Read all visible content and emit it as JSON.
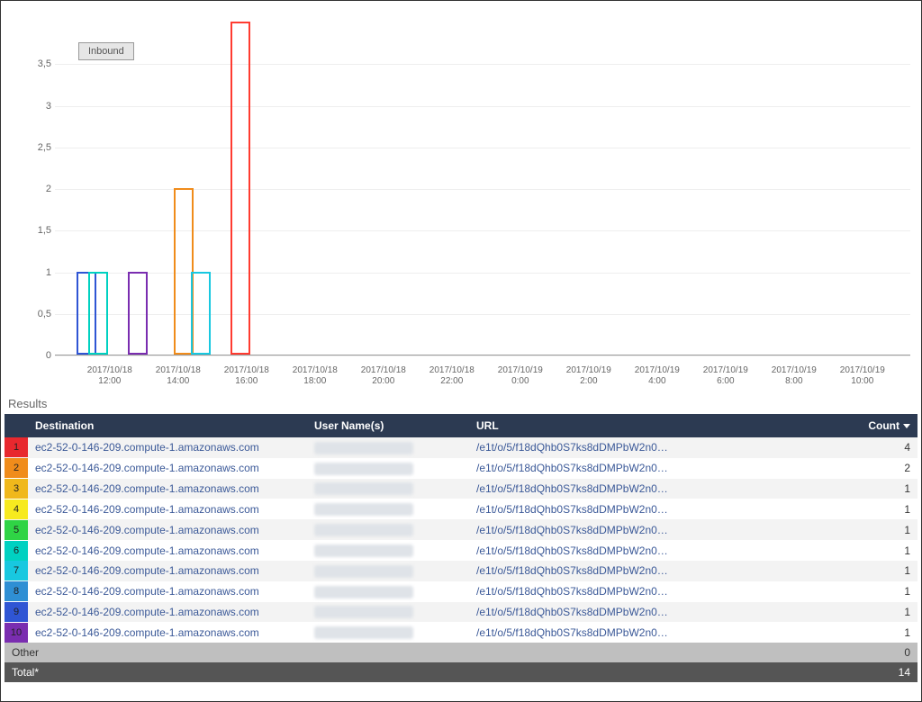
{
  "results_label": "Results",
  "legend": {
    "label": "Inbound"
  },
  "chart_data": {
    "type": "bar",
    "title": "",
    "xlabel": "",
    "ylabel": "",
    "ylim": [
      0,
      4
    ],
    "y_ticks": [
      0,
      0.5,
      1,
      1.5,
      2,
      2.5,
      3,
      3.5
    ],
    "x_ticks": [
      "2017/10/18\n12:00",
      "2017/10/18\n14:00",
      "2017/10/18\n16:00",
      "2017/10/18\n18:00",
      "2017/10/18\n20:00",
      "2017/10/18\n22:00",
      "2017/10/19\n0:00",
      "2017/10/19\n2:00",
      "2017/10/19\n4:00",
      "2017/10/19\n6:00",
      "2017/10/19\n8:00",
      "2017/10/19\n10:00"
    ],
    "series": [
      {
        "name": "1",
        "color": "#2f55d4",
        "x": "2017/10/18 11:20",
        "value": 1
      },
      {
        "name": "2",
        "color": "#00d1c1",
        "x": "2017/10/18 11:40",
        "value": 1
      },
      {
        "name": "3",
        "color": "#7a2db0",
        "x": "2017/10/18 12:50",
        "value": 1
      },
      {
        "name": "4",
        "color": "#f08c1b",
        "x": "2017/10/18 14:10",
        "value": 2
      },
      {
        "name": "5",
        "color": "#18c8e0",
        "x": "2017/10/18 14:40",
        "value": 1
      },
      {
        "name": "6",
        "color": "#ff3b30",
        "x": "2017/10/18 15:50",
        "value": 4
      }
    ],
    "legend": [
      "Inbound"
    ]
  },
  "table": {
    "headers": {
      "destination": "Destination",
      "user": "User Name(s)",
      "url": "URL",
      "count": "Count"
    },
    "rows": [
      {
        "idx": "1",
        "color": "#e8282e",
        "destination": "ec2-52-0-146-209.compute-1.amazonaws.com",
        "url": "/e1t/o/5/f18dQhb0S7ks8dDMPbW2n0…",
        "count": 4
      },
      {
        "idx": "2",
        "color": "#f08c1b",
        "destination": "ec2-52-0-146-209.compute-1.amazonaws.com",
        "url": "/e1t/o/5/f18dQhb0S7ks8dDMPbW2n0…",
        "count": 2
      },
      {
        "idx": "3",
        "color": "#f0b81b",
        "destination": "ec2-52-0-146-209.compute-1.amazonaws.com",
        "url": "/e1t/o/5/f18dQhb0S7ks8dDMPbW2n0…",
        "count": 1
      },
      {
        "idx": "4",
        "color": "#f7ea1f",
        "destination": "ec2-52-0-146-209.compute-1.amazonaws.com",
        "url": "/e1t/o/5/f18dQhb0S7ks8dDMPbW2n0…",
        "count": 1
      },
      {
        "idx": "5",
        "color": "#2fd445",
        "destination": "ec2-52-0-146-209.compute-1.amazonaws.com",
        "url": "/e1t/o/5/f18dQhb0S7ks8dDMPbW2n0…",
        "count": 1
      },
      {
        "idx": "6",
        "color": "#00d1c1",
        "destination": "ec2-52-0-146-209.compute-1.amazonaws.com",
        "url": "/e1t/o/5/f18dQhb0S7ks8dDMPbW2n0…",
        "count": 1
      },
      {
        "idx": "7",
        "color": "#18c8e0",
        "destination": "ec2-52-0-146-209.compute-1.amazonaws.com",
        "url": "/e1t/o/5/f18dQhb0S7ks8dDMPbW2n0…",
        "count": 1
      },
      {
        "idx": "8",
        "color": "#2f8fd4",
        "destination": "ec2-52-0-146-209.compute-1.amazonaws.com",
        "url": "/e1t/o/5/f18dQhb0S7ks8dDMPbW2n0…",
        "count": 1
      },
      {
        "idx": "9",
        "color": "#2f55d4",
        "destination": "ec2-52-0-146-209.compute-1.amazonaws.com",
        "url": "/e1t/o/5/f18dQhb0S7ks8dDMPbW2n0…",
        "count": 1
      },
      {
        "idx": "10",
        "color": "#7a2db0",
        "destination": "ec2-52-0-146-209.compute-1.amazonaws.com",
        "url": "/e1t/o/5/f18dQhb0S7ks8dDMPbW2n0…",
        "count": 1
      }
    ],
    "other": {
      "label": "Other",
      "count": 0
    },
    "total": {
      "label": "Total*",
      "count": 14
    }
  }
}
